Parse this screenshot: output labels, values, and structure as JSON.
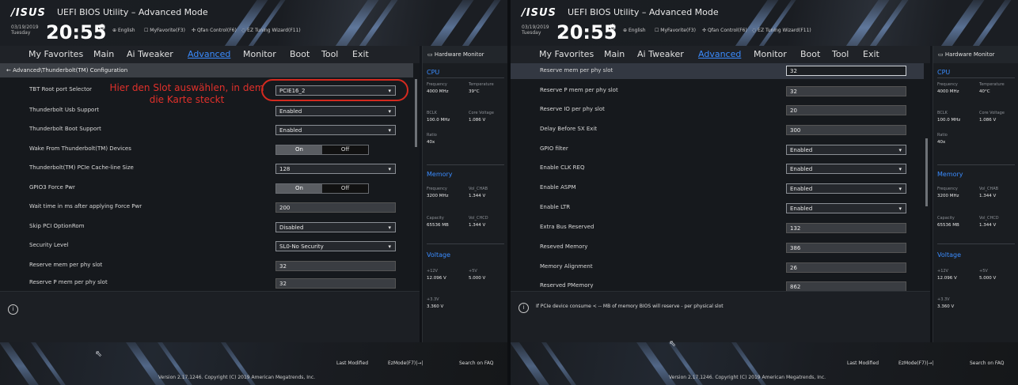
{
  "brand": {
    "logo": "/ISUS",
    "title": "UEFI BIOS Utility – Advanced Mode"
  },
  "header": {
    "date": "03/19/2019",
    "day": "Tuesday",
    "time": "20:55",
    "quick": [
      "English",
      "MyFavorite(F3)",
      "Qfan Control(F6)",
      "EZ Tuning Wizard(F11)"
    ]
  },
  "menu": [
    "My Favorites",
    "Main",
    "Ai Tweaker",
    "Advanced",
    "Monitor",
    "Boot",
    "Tool",
    "Exit"
  ],
  "left": {
    "breadcrumb": "Advanced\\Thunderbolt(TM) Configuration",
    "annotation": "Hier den Slot auswählen, in dem die Karte steckt",
    "rows": [
      {
        "label": "TBT Root port Selector",
        "value": "PCIE16_2"
      },
      {
        "label": "Thunderbolt Usb Support",
        "value": "Enabled"
      },
      {
        "label": "Thunderbolt Boot Support",
        "value": "Enabled"
      },
      {
        "label": "Wake From Thunderbolt(TM) Devices",
        "on": "On",
        "off": "Off"
      },
      {
        "label": "Thunderbolt(TM) PCIe Cache-line Size",
        "value": "128"
      },
      {
        "label": "GPIO3 Force Pwr",
        "on": "On",
        "off": "Off"
      },
      {
        "label": "Wait time in ms after applying Force Pwr",
        "value": "200"
      },
      {
        "label": "Skip PCI OptionRom",
        "value": "Disabled"
      },
      {
        "label": "Security Level",
        "value": "SL0-No Security"
      },
      {
        "label": "Reserve mem per phy slot",
        "value": "32"
      },
      {
        "label": "Reserve P mem per phy slot",
        "value": "32"
      }
    ]
  },
  "right": {
    "rows": [
      {
        "label": "Reserve mem per phy slot",
        "value": "32"
      },
      {
        "label": "Reserve P mem per phy slot",
        "value": "32"
      },
      {
        "label": "Reserve IO per phy slot",
        "value": "20"
      },
      {
        "label": "Delay Before SX Exit",
        "value": "300"
      },
      {
        "label": "GPIO filter",
        "value": "Enabled"
      },
      {
        "label": "Enable CLK REQ",
        "value": "Enabled"
      },
      {
        "label": "Enable ASPM",
        "value": "Enabled"
      },
      {
        "label": "Enable LTR",
        "value": "Enabled"
      },
      {
        "label": "Extra Bus Reserved",
        "value": "132"
      },
      {
        "label": "Reseved Memory",
        "value": "386"
      },
      {
        "label": "Memory Alignment",
        "value": "26"
      },
      {
        "label": "Reserved PMemory",
        "value": "862"
      }
    ],
    "help": "If PCIe device consume < -- MB of memory BIOS will reserve - per physical slot"
  },
  "hw": {
    "title": "Hardware Monitor",
    "cpu": "CPU",
    "freq_l": "Frequency",
    "freq_v": "4000 MHz",
    "temp_l": "Temperature",
    "temp_v_left": "39°C",
    "temp_v_right": "40°C",
    "bclk_l": "BCLK",
    "bclk_v": "100.0 MHz",
    "core_l": "Core Voltage",
    "core_v": "1.086 V",
    "ratio_l": "Ratio",
    "ratio_v": "40x",
    "memory": "Memory",
    "mfreq_l": "Frequency",
    "mfreq_v": "3200 MHz",
    "vdd_l": "Vol_CHAB",
    "vdd_v": "1.344 V",
    "cap_l": "Capacity",
    "cap_v": "65536 MB",
    "vdd2_l": "Vol_CHCD",
    "vdd2_v": "1.344 V",
    "voltage": "Voltage",
    "v12_l": "+12V",
    "v12_v": "12.096 V",
    "v5_l": "+5V",
    "v5_v": "5.000 V",
    "v33_l": "+3.3V",
    "v33_v": "3.360 V"
  },
  "footer": {
    "last": "Last Modified",
    "ezmode": "EzMode(F7)|→|",
    "search": "Search on FAQ",
    "copyright": "Version 2.17.1246. Copyright (C) 2019 American Megatrends, Inc."
  }
}
